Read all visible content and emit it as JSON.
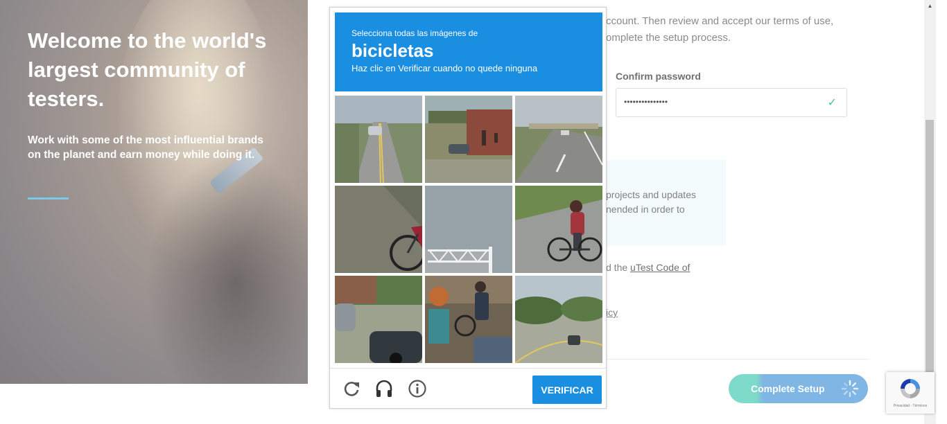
{
  "hero": {
    "title": "Welcome to the world's largest community of testers.",
    "subtitle": "Work with some of the most influential brands on the planet and earn money while doing it."
  },
  "form": {
    "intro_line1": "ccount. Then review and accept our terms of use,",
    "intro_line2": "omplete the setup process.",
    "confirm_password_label": "Confirm password",
    "confirm_password_value": "•••••••••••••••",
    "info_text": "projects and updates\nnended in order to",
    "code_prefix": "d the ",
    "code_link": "uTest Code of",
    "policy_fragment": "icy",
    "complete_button": "Complete Setup"
  },
  "captcha": {
    "instruction": "Selecciona todas las imágenes de",
    "target": "bicicletas",
    "hint": "Haz clic en Verificar cuando no quede ninguna",
    "verify_label": "VERIFICAR",
    "tools": [
      "reload-icon",
      "audio-icon",
      "info-icon"
    ]
  },
  "recaptcha_badge": {
    "fine_print": "Privacidad - Términos"
  },
  "colors": {
    "captcha_blue": "#1a8ee1",
    "accent_line": "#7cc9e6",
    "check_green": "#4ec39a"
  }
}
